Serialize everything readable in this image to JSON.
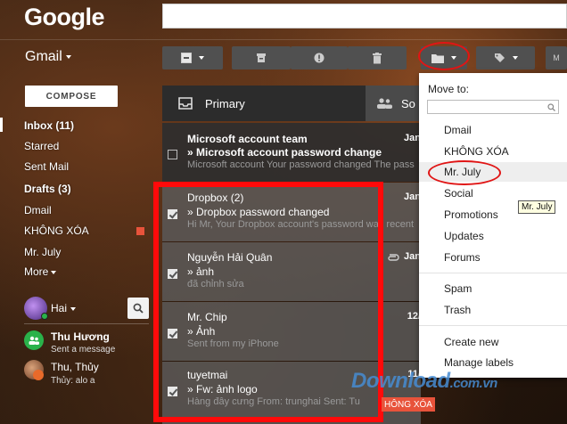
{
  "header": {
    "logo": "Google",
    "app_name": "Gmail"
  },
  "sidebar": {
    "compose_label": "COMPOSE",
    "items": [
      {
        "label": "Inbox (11)",
        "bold": true,
        "active": true
      },
      {
        "label": "Starred",
        "bold": false
      },
      {
        "label": "Sent Mail",
        "bold": false
      },
      {
        "label": "Drafts (3)",
        "bold": true
      },
      {
        "label": "Dmail",
        "bold": false
      },
      {
        "label": "KHÔNG XÓA",
        "bold": false,
        "label_color": "#e8533b"
      },
      {
        "label": "Mr. July",
        "bold": false
      },
      {
        "label": "More",
        "bold": false
      }
    ]
  },
  "hangouts": {
    "user_name": "Hai",
    "contacts": [
      {
        "name": "Thu Hương",
        "status": "Sent a message"
      },
      {
        "name": "Thu, Thủy",
        "status": "Thủy: alo a"
      }
    ]
  },
  "tabs": [
    {
      "label": "Primary",
      "icon": "inbox-icon",
      "active": true
    },
    {
      "label": "So",
      "icon": "people-icon",
      "active": false
    }
  ],
  "emails": [
    {
      "sender": "Microsoft account team",
      "subject": "» Microsoft account password change",
      "snippet": "Microsoft account Your password changed The pass",
      "date": "Jan",
      "checked": false,
      "unread": true
    },
    {
      "sender": "Dropbox (2)",
      "subject": "» Dropbox password changed",
      "snippet": "Hi Mr, Your Dropbox account's password was recent",
      "date": "Jan",
      "checked": true,
      "unread": false
    },
    {
      "sender": "Nguyễn Hải Quân",
      "subject": "» ảnh",
      "snippet": "đã chỉnh sửa",
      "date": "Jan",
      "checked": true,
      "unread": false,
      "attachment": true
    },
    {
      "sender": "Mr. Chip",
      "subject": "» Ảnh",
      "snippet": "Sent from my iPhone",
      "date": "12/",
      "checked": true,
      "unread": false
    },
    {
      "sender": "tuyetmai",
      "subject": "» Fw: ảnh logo",
      "snippet": "Hàng đây cưng From: trunghai Sent: Tu",
      "date": "11/",
      "checked": true,
      "unread": false
    }
  ],
  "label_tag": "HÔNG XÓA",
  "move_menu": {
    "title": "Move to:",
    "filter_value": "",
    "folders": [
      "Dmail",
      "KHÔNG XÓA",
      "Mr. July",
      "Social",
      "Promotions",
      "Updates",
      "Forums"
    ],
    "system": [
      "Spam",
      "Trash"
    ],
    "actions": [
      "Create new",
      "Manage labels"
    ],
    "highlighted": "Mr. July"
  },
  "tooltip": "Mr. July",
  "watermark": {
    "main": "Download",
    "suffix": ".com.vn"
  },
  "colors": {
    "accent_red": "#ff0a0a",
    "label_orange": "#e8533b",
    "toolbar_gray": "#505050"
  }
}
